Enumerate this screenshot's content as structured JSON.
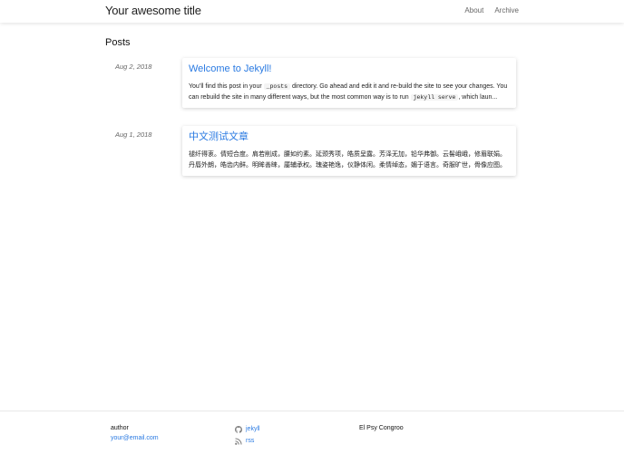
{
  "header": {
    "site_title": "Your awesome title",
    "nav": [
      {
        "label": "About"
      },
      {
        "label": "Archive"
      }
    ]
  },
  "main": {
    "heading": "Posts",
    "posts": [
      {
        "date": "Aug 2, 2018",
        "title": "Welcome to Jekyll!",
        "excerpt_part1": "You’ll find this post in your ",
        "code1": "_posts",
        "excerpt_part2": " directory. Go ahead and edit it and re-build the site to see your changes. You can rebuild the site in many different ways, but the most common way is to run ",
        "code2": "jekyll serve",
        "excerpt_part3": ", which laun..."
      },
      {
        "date": "Aug 1, 2018",
        "title": "中文测试文章",
        "excerpt": "褪纤得衷。倩短合度。肩若削成，腰如约素。延颈秀项，皓质呈露。芳泽无加，铅华弗御。云髻峨峨，修眉联娟。丹唇外朗，皓齿内鲜。明眸善睐，靥辅承权。瑰姿艳逸，仪静体闲。柔情绰态，媚于语言。奇服旷世，骨像应图。"
      }
    ]
  },
  "footer": {
    "author_label": "author",
    "email": "your@email.com",
    "links": [
      {
        "icon": "github-icon",
        "label": "jekyll"
      },
      {
        "icon": "rss-icon",
        "label": "rss"
      }
    ],
    "tagline": "El Psy Congroo"
  },
  "colors": {
    "link": "#2a7ae2",
    "muted": "#666666",
    "text": "#111111"
  }
}
